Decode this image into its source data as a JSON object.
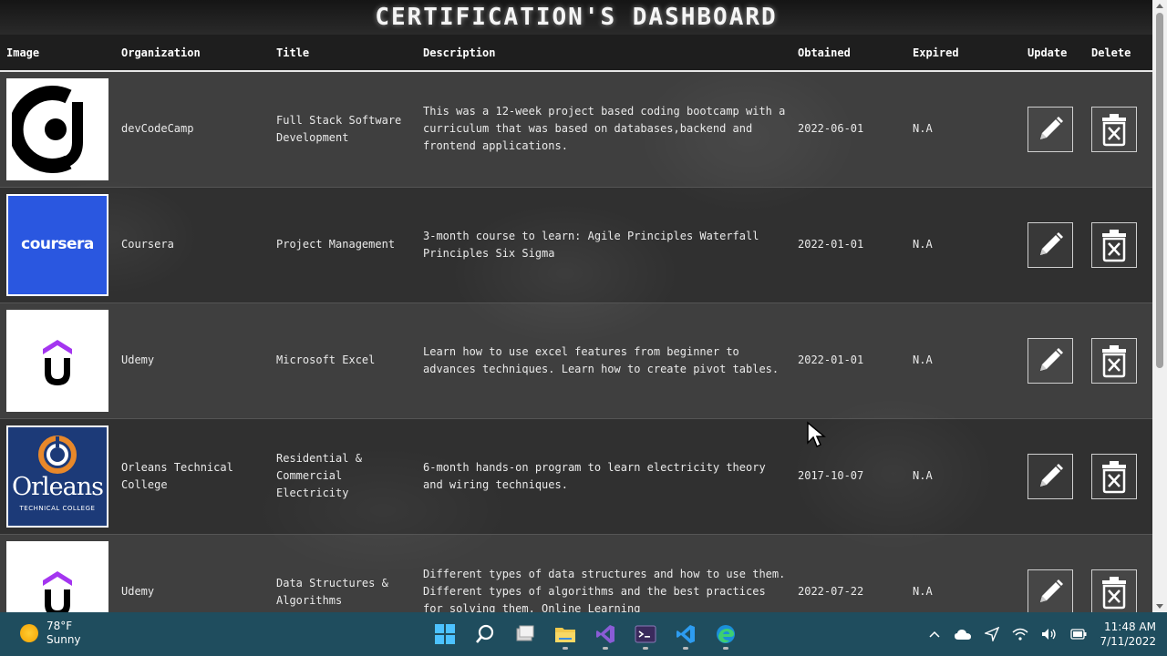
{
  "page": {
    "title": "CERTIFICATION'S DASHBOARD"
  },
  "table": {
    "headers": [
      "Image",
      "Organization",
      "Title",
      "Description",
      "Obtained",
      "Expired",
      "Update",
      "Delete"
    ],
    "rows": [
      {
        "logo": "devcodecamp-logo",
        "organization": "devCodeCamp",
        "title": "Full Stack Software Development",
        "description": "This was a 12-week project based coding bootcamp with a curriculum that was based on databases,backend and frontend applications.",
        "obtained": "2022-06-01",
        "expired": "N.A"
      },
      {
        "logo": "coursera-logo",
        "logo_text": "coursera",
        "organization": "Coursera",
        "title": "Project Management",
        "description": "3-month course to learn: Agile Principles Waterfall Principles Six Sigma",
        "obtained": "2022-01-01",
        "expired": "N.A"
      },
      {
        "logo": "udemy-logo",
        "organization": "Udemy",
        "title": "Microsoft Excel",
        "description": "Learn how to use excel features from beginner to advances techniques. Learn how to create pivot tables.",
        "obtained": "2022-01-01",
        "expired": "N.A"
      },
      {
        "logo": "orleans-logo",
        "logo_text": "Orleans",
        "logo_subtext": "TECHNICAL COLLEGE",
        "organization": "Orleans Technical College",
        "title": "Residential & Commercial Electricity",
        "description": "6-month hands-on program to learn electricity theory and wiring techniques.",
        "obtained": "2017-10-07",
        "expired": "N.A"
      },
      {
        "logo": "udemy-logo",
        "organization": "Udemy",
        "title": "Data Structures & Algorithms",
        "description": "Different types of data structures and how to use them. Different types of algorithms and the best practices for solving them. Online Learning",
        "obtained": "2022-07-22",
        "expired": "N.A"
      }
    ]
  },
  "taskbar": {
    "weather": {
      "temp": "78°F",
      "condition": "Sunny"
    },
    "apps": [
      "start-icon",
      "search-icon",
      "task-view-icon",
      "file-explorer-icon",
      "visual-studio-icon",
      "terminal-icon",
      "vscode-icon",
      "edge-icon"
    ],
    "clock": {
      "time": "11:48 AM",
      "date": "7/11/2022"
    }
  },
  "colors": {
    "taskbar": "#1f4d5e",
    "coursera_blue": "#2a57e0",
    "orleans_blue": "#1c3a78",
    "udemy_purple": "#a435f0"
  }
}
